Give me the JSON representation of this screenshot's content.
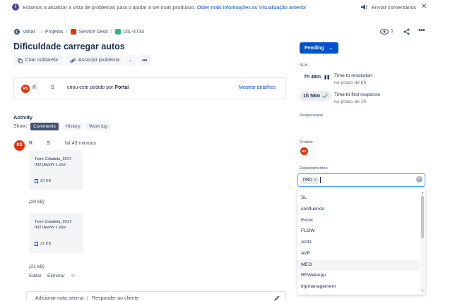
{
  "banner": {
    "text": "Estamos a atualizar a vista de problemas para o ajudar a ser mais produtivo.",
    "link_more": "Obter mais informações",
    "or": "ou",
    "link_previous": "Visualização anterior",
    "feedback": "Enviar comentários"
  },
  "breadcrumb": {
    "back": "Voltar",
    "projects": "Projetos",
    "service_desk": "Service Desk",
    "issue_key": "OIL-4733"
  },
  "header": {
    "watchers": "1"
  },
  "issue": {
    "title": "Dificuldade carregar autos"
  },
  "actions": {
    "subtask": "Criar subtarefa",
    "link": "Associar problema"
  },
  "request": {
    "avatar": "RS",
    "name_first": "R",
    "name_last": "S",
    "text": "criou este pedido por",
    "channel": "Portal",
    "details": "Mostrar detalhes"
  },
  "activity": {
    "heading": "Activity",
    "show": "Show:",
    "tabs": [
      "Comments",
      "History",
      "Work log"
    ],
    "comment": {
      "avatar": "RS",
      "author_first": "R",
      "author_last": "S",
      "time": "há 43 minutos",
      "attachments": [
        {
          "name": "Torre Cidadela_2017-0021AutoN 1.xlsx",
          "size": "20 KB",
          "size_paren": "(20 kB)"
        },
        {
          "name": "Torre Cidadela_2017-0021AutoN 1.xlsx",
          "size": "21 KB",
          "size_paren": "(21 kB)"
        }
      ],
      "edit": "Editar",
      "dot": "·",
      "delete": "Eliminar"
    },
    "footer": {
      "internal": "Adicionar nota interna",
      "slash": "/",
      "reply": "Responder ao cliente"
    }
  },
  "sidebar": {
    "status": "Pending",
    "sla_label": "SLA",
    "sla": [
      {
        "time": "7h 48m",
        "name": "Time to resolution",
        "sub": "no prazo de 6h"
      },
      {
        "time": "1h 58m",
        "name": "Time to first response",
        "sub": "no prazo de 2h"
      }
    ],
    "assignee_label": "Responsável",
    "reporter_label": "Criador",
    "reporter_avatar": "RS",
    "departments_label": "Departamentos",
    "selected_tag": "PRD",
    "options": [
      "SL",
      "confluence",
      "Excel",
      "FLOW",
      "AON",
      "AVP",
      "MEO",
      "RFWebApp",
      "tripmanagement"
    ]
  },
  "colors": {
    "accent": "#0052cc",
    "status": "#0052cc",
    "avatar": "#de350b",
    "check": "#36b37e"
  }
}
